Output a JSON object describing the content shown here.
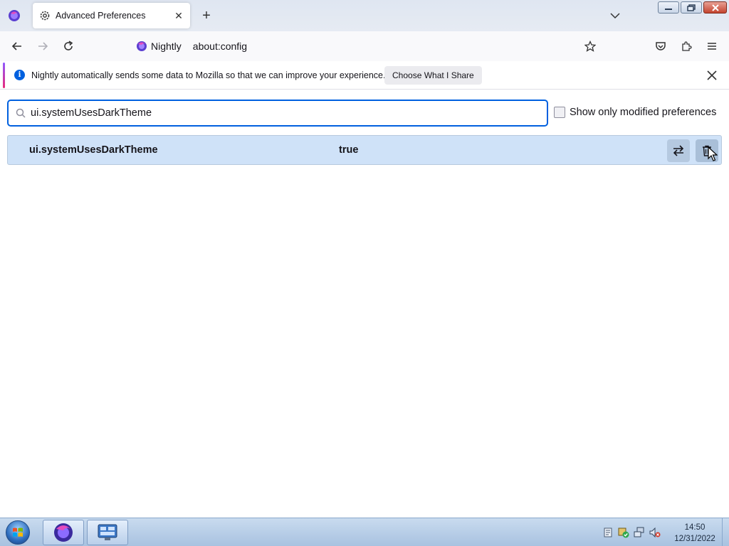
{
  "tab": {
    "title": "Advanced Preferences",
    "icon": "gear-icon"
  },
  "toolbar": {
    "identity_brand": "Nightly",
    "url": "about:config"
  },
  "notification": {
    "message": "Nightly automatically sends some data to Mozilla so that we can improve your experience.",
    "button_label": "Choose What I Share"
  },
  "config": {
    "search_value": "ui.systemUsesDarkTheme",
    "modified_only_label": "Show only modified preferences",
    "modified_only_checked": false,
    "pref": {
      "name": "ui.systemUsesDarkTheme",
      "value": "true"
    }
  },
  "taskbar": {
    "time": "14:50",
    "date": "12/31/2022"
  },
  "colors": {
    "accent_blue": "#0060df",
    "row_highlight": "#cfe2f8",
    "close_red": "#c4442f"
  }
}
